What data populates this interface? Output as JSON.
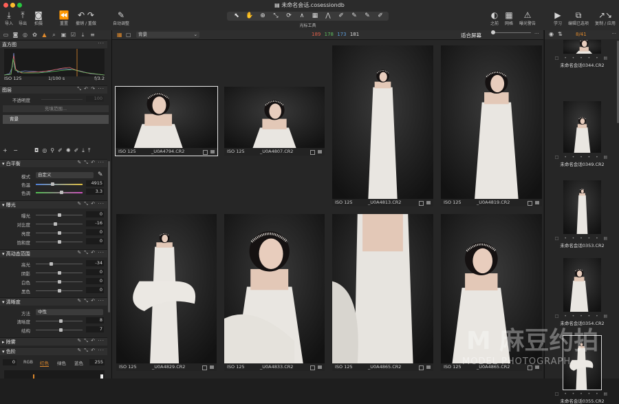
{
  "window": {
    "title": "未命名会话.cosessiondb",
    "file_icon": "document-icon"
  },
  "toolbar": {
    "left_buttons": [
      {
        "label": "导入",
        "icon": "import-icon",
        "glyph": "⤓"
      },
      {
        "label": "导出",
        "icon": "export-icon",
        "glyph": "⤒"
      },
      {
        "label": "拍摄",
        "icon": "camera-icon",
        "glyph": "◙"
      },
      {
        "label": "重置",
        "icon": "reset-icon",
        "glyph": "⏪"
      },
      {
        "label": "撤销 / 重做",
        "icon": "undo-redo-icon",
        "glyph": "↶ ↷"
      },
      {
        "label": "自动调整",
        "icon": "magic-wand-icon",
        "glyph": "✎"
      }
    ],
    "cursor_tools_label": "光标工具",
    "cursor_tools": [
      "⬉",
      "✋",
      "⊕",
      "⤡",
      "⟳",
      "∧",
      "▦",
      "⋀",
      "✐",
      "✎",
      "✎",
      "✐"
    ],
    "right_buttons": [
      {
        "label": "之前",
        "icon": "before-icon",
        "glyph": "◐"
      },
      {
        "label": "网格",
        "icon": "grid-icon",
        "glyph": "▦"
      },
      {
        "label": "曝光警告",
        "icon": "warning-icon",
        "glyph": "⚠"
      },
      {
        "label": "学习",
        "icon": "play-icon",
        "glyph": "▶"
      },
      {
        "label": "编辑已选项",
        "icon": "edit-selected-icon",
        "glyph": "⧉"
      },
      {
        "label": "复制 / 应用",
        "icon": "copy-apply-icon",
        "glyph": "↗↘"
      }
    ]
  },
  "left_panel": {
    "histogram": {
      "title": "直方图",
      "iso": "ISO 125",
      "shutter": "1/100 s",
      "aperture": "f/3.2"
    },
    "layers": {
      "title": "图层",
      "opacity_label": "不透明度",
      "opacity_value": "100",
      "fill_mask_label": "充填范围...",
      "background_layer": "背景"
    },
    "white_balance": {
      "title": "白平衡",
      "mode_label": "模式",
      "mode_value": "自定义",
      "kelvin_label": "色温",
      "kelvin_value": "4915",
      "tint_label": "色调",
      "tint_value": "3.3"
    },
    "exposure": {
      "title": "曝光",
      "rows": [
        {
          "label": "曝光",
          "value": "0",
          "pos": 0.5
        },
        {
          "label": "对比度",
          "value": "-16",
          "pos": 0.42
        },
        {
          "label": "亮度",
          "value": "0",
          "pos": 0.5
        },
        {
          "label": "饱和度",
          "value": "0",
          "pos": 0.5
        }
      ]
    },
    "hdr": {
      "title": "高动态范围",
      "rows": [
        {
          "label": "高光",
          "value": "-34",
          "pos": 0.33
        },
        {
          "label": "阴影",
          "value": "0",
          "pos": 0.5
        },
        {
          "label": "白色",
          "value": "0",
          "pos": 0.5
        },
        {
          "label": "黑色",
          "value": "0",
          "pos": 0.5
        }
      ]
    },
    "clarity": {
      "title": "清晰度",
      "method_label": "方法",
      "method_value": "中性",
      "rows": [
        {
          "label": "清晰度",
          "value": "8",
          "pos": 0.54
        },
        {
          "label": "结构",
          "value": "7",
          "pos": 0.53
        }
      ]
    },
    "dehaze": {
      "title": "除雾"
    },
    "levels": {
      "title": "色阶",
      "left_value": "0",
      "channels": [
        "RGB",
        "红色",
        "绿色",
        "蓝色"
      ],
      "active_channel": "红色",
      "right_value": "255"
    }
  },
  "viewer": {
    "layer_select": "背景",
    "counts": {
      "red": "189",
      "green": "178",
      "blue": "173",
      "white": "181"
    },
    "fit_label": "适合屏幕",
    "photos": [
      {
        "iso": "ISO 125",
        "file": "_U0A4794.CR2",
        "selected": true
      },
      {
        "iso": "ISO 125",
        "file": "_U0A4807.CR2",
        "selected": false
      },
      {
        "iso": "ISO 125",
        "file": "_U0A4813.CR2",
        "selected": false
      },
      {
        "iso": "ISO 125",
        "file": "_U0A4819.CR2",
        "selected": false
      },
      {
        "iso": "ISO 125",
        "file": "_U0A4829.CR2",
        "selected": false
      },
      {
        "iso": "ISO 125",
        "file": "_U0A4833.CR2",
        "selected": false
      },
      {
        "iso": "ISO 125",
        "file": "_U0A4865.CR2",
        "selected": false
      },
      {
        "iso": "ISO 125",
        "file": "_U0A4865.CR2",
        "selected": false
      }
    ]
  },
  "browser": {
    "count": "8/41",
    "items": [
      "未命名会话0344.CR2",
      "未命名会话0349.CR2",
      "未命名会话0353.CR2",
      "未命名会话0354.CR2",
      "未命名会话0355.CR2"
    ]
  },
  "watermark": {
    "main": "M 麻豆约拍",
    "sub": "MODEL PHOTOGRAPH"
  },
  "colors": {
    "accent_orange": "#e08a2c",
    "red": "#e0604a",
    "green": "#5fbf5f",
    "blue": "#5b9bd8"
  }
}
